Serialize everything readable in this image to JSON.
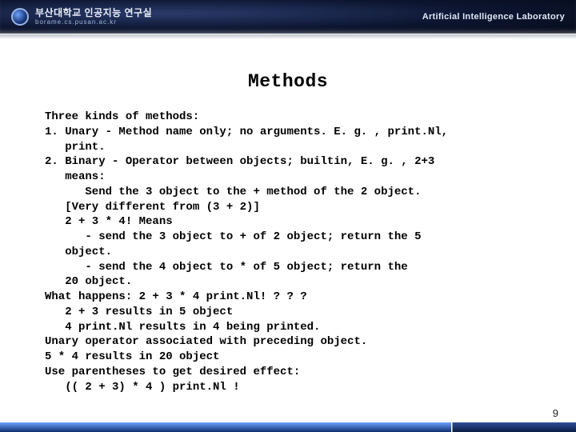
{
  "header": {
    "organization": "부산대학교 인공지능 연구실",
    "url": "borame.cs.pusan.ac.kr",
    "lab": "Artificial Intelligence Laboratory"
  },
  "slide": {
    "title": "Methods",
    "body": "Three kinds of methods:\n1. Unary - Method name only; no arguments. E. g. , print.Nl,\n   print.\n2. Binary - Operator between objects; builtin, E. g. , 2+3\n   means:\n      Send the 3 object to the + method of the 2 object.\n   [Very different from (3 + 2)]\n   2 + 3 * 4! Means\n      - send the 3 object to + of 2 object; return the 5\n   object.\n      - send the 4 object to * of 5 object; return the\n   20 object.\nWhat happens: 2 + 3 * 4 print.Nl! ? ? ?\n   2 + 3 results in 5 object\n   4 print.Nl results in 4 being printed.\nUnary operator associated with preceding object.\n5 * 4 results in 20 object\nUse parentheses to get desired effect:\n   (( 2 + 3) * 4 ) print.Nl !",
    "page": "9"
  }
}
